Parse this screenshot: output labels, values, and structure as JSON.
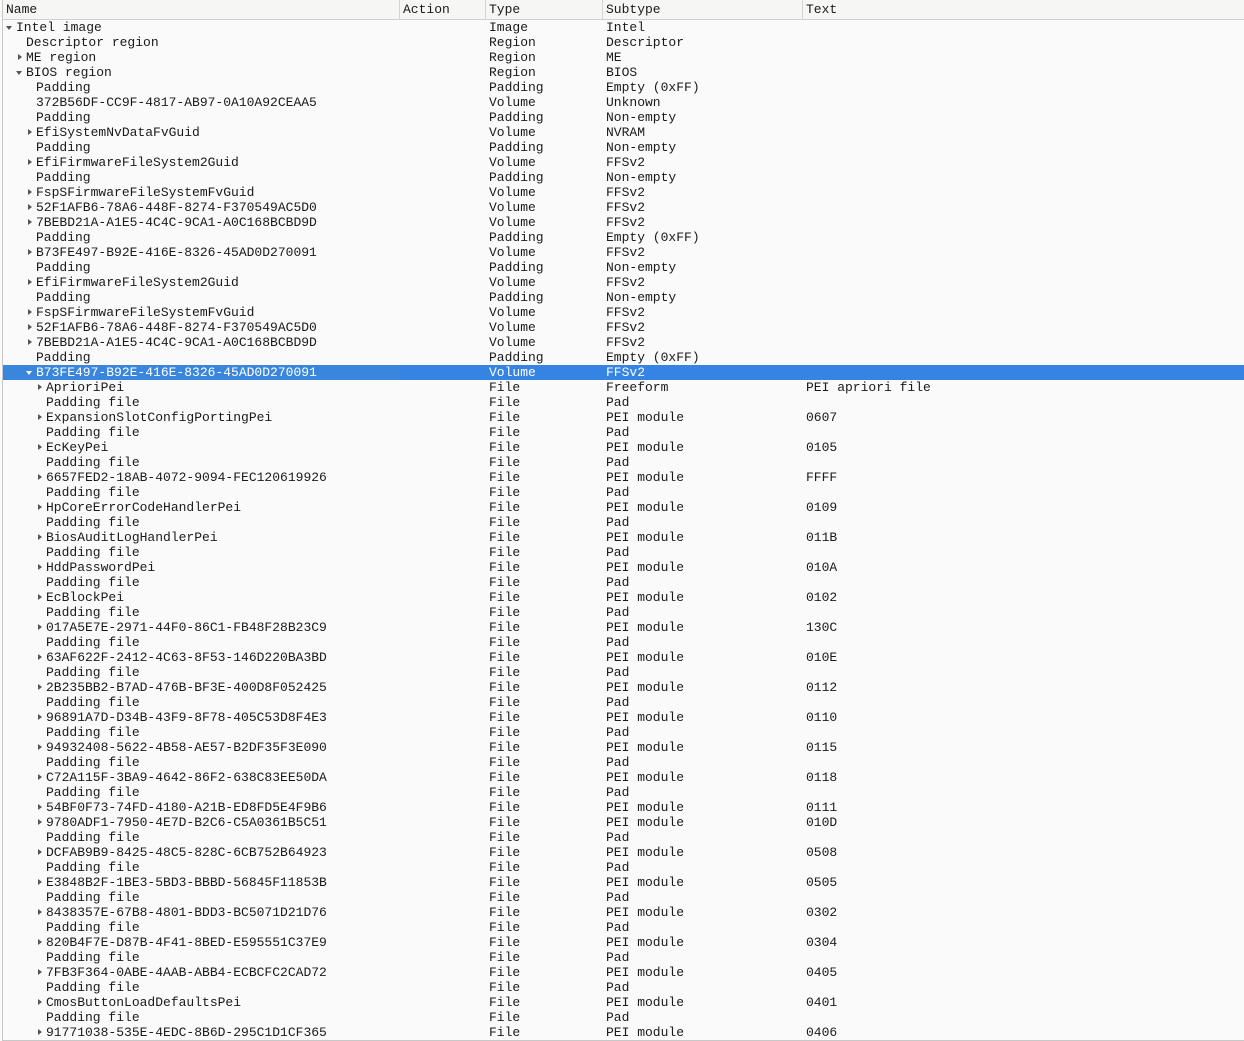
{
  "columns": [
    "Name",
    "Action",
    "Type",
    "Subtype",
    "Text"
  ],
  "selected_index": 23,
  "rows": [
    [
      0,
      "down",
      "Intel image",
      "Image",
      "Intel",
      ""
    ],
    [
      1,
      "",
      "Descriptor region",
      "Region",
      "Descriptor",
      ""
    ],
    [
      1,
      "right",
      "ME region",
      "Region",
      "ME",
      ""
    ],
    [
      1,
      "down",
      "BIOS region",
      "Region",
      "BIOS",
      ""
    ],
    [
      2,
      "",
      "Padding",
      "Padding",
      "Empty (0xFF)",
      ""
    ],
    [
      2,
      "",
      "372B56DF-CC9F-4817-AB97-0A10A92CEAA5",
      "Volume",
      "Unknown",
      ""
    ],
    [
      2,
      "",
      "Padding",
      "Padding",
      "Non-empty",
      ""
    ],
    [
      2,
      "right",
      "EfiSystemNvDataFvGuid",
      "Volume",
      "NVRAM",
      ""
    ],
    [
      2,
      "",
      "Padding",
      "Padding",
      "Non-empty",
      ""
    ],
    [
      2,
      "right",
      "EfiFirmwareFileSystem2Guid",
      "Volume",
      "FFSv2",
      ""
    ],
    [
      2,
      "",
      "Padding",
      "Padding",
      "Non-empty",
      ""
    ],
    [
      2,
      "right",
      "FspSFirmwareFileSystemFvGuid",
      "Volume",
      "FFSv2",
      ""
    ],
    [
      2,
      "right",
      "52F1AFB6-78A6-448F-8274-F370549AC5D0",
      "Volume",
      "FFSv2",
      ""
    ],
    [
      2,
      "right",
      "7BEBD21A-A1E5-4C4C-9CA1-A0C168BCBD9D",
      "Volume",
      "FFSv2",
      ""
    ],
    [
      2,
      "",
      "Padding",
      "Padding",
      "Empty (0xFF)",
      ""
    ],
    [
      2,
      "right",
      "B73FE497-B92E-416E-8326-45AD0D270091",
      "Volume",
      "FFSv2",
      ""
    ],
    [
      2,
      "",
      "Padding",
      "Padding",
      "Non-empty",
      ""
    ],
    [
      2,
      "right",
      "EfiFirmwareFileSystem2Guid",
      "Volume",
      "FFSv2",
      ""
    ],
    [
      2,
      "",
      "Padding",
      "Padding",
      "Non-empty",
      ""
    ],
    [
      2,
      "right",
      "FspSFirmwareFileSystemFvGuid",
      "Volume",
      "FFSv2",
      ""
    ],
    [
      2,
      "right",
      "52F1AFB6-78A6-448F-8274-F370549AC5D0",
      "Volume",
      "FFSv2",
      ""
    ],
    [
      2,
      "right",
      "7BEBD21A-A1E5-4C4C-9CA1-A0C168BCBD9D",
      "Volume",
      "FFSv2",
      ""
    ],
    [
      2,
      "",
      "Padding",
      "Padding",
      "Empty (0xFF)",
      ""
    ],
    [
      2,
      "down",
      "B73FE497-B92E-416E-8326-45AD0D270091",
      "Volume",
      "FFSv2",
      ""
    ],
    [
      3,
      "right",
      "AprioriPei",
      "File",
      "Freeform",
      "PEI apriori file"
    ],
    [
      3,
      "",
      "Padding file",
      "File",
      "Pad",
      ""
    ],
    [
      3,
      "right",
      "ExpansionSlotConfigPortingPei",
      "File",
      "PEI module",
      "0607"
    ],
    [
      3,
      "",
      "Padding file",
      "File",
      "Pad",
      ""
    ],
    [
      3,
      "right",
      "EcKeyPei",
      "File",
      "PEI module",
      "0105"
    ],
    [
      3,
      "",
      "Padding file",
      "File",
      "Pad",
      ""
    ],
    [
      3,
      "right",
      "6657FED2-18AB-4072-9094-FEC120619926",
      "File",
      "PEI module",
      "FFFF"
    ],
    [
      3,
      "",
      "Padding file",
      "File",
      "Pad",
      ""
    ],
    [
      3,
      "right",
      "HpCoreErrorCodeHandlerPei",
      "File",
      "PEI module",
      "0109"
    ],
    [
      3,
      "",
      "Padding file",
      "File",
      "Pad",
      ""
    ],
    [
      3,
      "right",
      "BiosAuditLogHandlerPei",
      "File",
      "PEI module",
      "011B"
    ],
    [
      3,
      "",
      "Padding file",
      "File",
      "Pad",
      ""
    ],
    [
      3,
      "right",
      "HddPasswordPei",
      "File",
      "PEI module",
      "010A"
    ],
    [
      3,
      "",
      "Padding file",
      "File",
      "Pad",
      ""
    ],
    [
      3,
      "right",
      "EcBlockPei",
      "File",
      "PEI module",
      "0102"
    ],
    [
      3,
      "",
      "Padding file",
      "File",
      "Pad",
      ""
    ],
    [
      3,
      "right",
      "017A5E7E-2971-44F0-86C1-FB48F28B23C9",
      "File",
      "PEI module",
      "130C"
    ],
    [
      3,
      "",
      "Padding file",
      "File",
      "Pad",
      ""
    ],
    [
      3,
      "right",
      "63AF622F-2412-4C63-8F53-146D220BA3BD",
      "File",
      "PEI module",
      "010E"
    ],
    [
      3,
      "",
      "Padding file",
      "File",
      "Pad",
      ""
    ],
    [
      3,
      "right",
      "2B235BB2-B7AD-476B-BF3E-400D8F052425",
      "File",
      "PEI module",
      "0112"
    ],
    [
      3,
      "",
      "Padding file",
      "File",
      "Pad",
      ""
    ],
    [
      3,
      "right",
      "96891A7D-D34B-43F9-8F78-405C53D8F4E3",
      "File",
      "PEI module",
      "0110"
    ],
    [
      3,
      "",
      "Padding file",
      "File",
      "Pad",
      ""
    ],
    [
      3,
      "right",
      "94932408-5622-4B58-AE57-B2DF35F3E090",
      "File",
      "PEI module",
      "0115"
    ],
    [
      3,
      "",
      "Padding file",
      "File",
      "Pad",
      ""
    ],
    [
      3,
      "right",
      "C72A115F-3BA9-4642-86F2-638C83EE50DA",
      "File",
      "PEI module",
      "0118"
    ],
    [
      3,
      "",
      "Padding file",
      "File",
      "Pad",
      ""
    ],
    [
      3,
      "right",
      "54BF0F73-74FD-4180-A21B-ED8FD5E4F9B6",
      "File",
      "PEI module",
      "0111"
    ],
    [
      3,
      "right",
      "9780ADF1-7950-4E7D-B2C6-C5A0361B5C51",
      "File",
      "PEI module",
      "010D"
    ],
    [
      3,
      "",
      "Padding file",
      "File",
      "Pad",
      ""
    ],
    [
      3,
      "right",
      "DCFAB9B9-8425-48C5-828C-6CB752B64923",
      "File",
      "PEI module",
      "0508"
    ],
    [
      3,
      "",
      "Padding file",
      "File",
      "Pad",
      ""
    ],
    [
      3,
      "right",
      "E3848B2F-1BE3-5BD3-BBBD-56845F11853B",
      "File",
      "PEI module",
      "0505"
    ],
    [
      3,
      "",
      "Padding file",
      "File",
      "Pad",
      ""
    ],
    [
      3,
      "right",
      "8438357E-67B8-4801-BDD3-BC5071D21D76",
      "File",
      "PEI module",
      "0302"
    ],
    [
      3,
      "",
      "Padding file",
      "File",
      "Pad",
      ""
    ],
    [
      3,
      "right",
      "820B4F7E-D87B-4F41-8BED-E595551C37E9",
      "File",
      "PEI module",
      "0304"
    ],
    [
      3,
      "",
      "Padding file",
      "File",
      "Pad",
      ""
    ],
    [
      3,
      "right",
      "7FB3F364-0ABE-4AAB-ABB4-ECBCFC2CAD72",
      "File",
      "PEI module",
      "0405"
    ],
    [
      3,
      "",
      "Padding file",
      "File",
      "Pad",
      ""
    ],
    [
      3,
      "right",
      "CmosButtonLoadDefaultsPei",
      "File",
      "PEI module",
      "0401"
    ],
    [
      3,
      "",
      "Padding file",
      "File",
      "Pad",
      ""
    ],
    [
      3,
      "right",
      "91771038-535E-4EDC-8B6D-295C1D1CF365",
      "File",
      "PEI module",
      "0406"
    ]
  ]
}
